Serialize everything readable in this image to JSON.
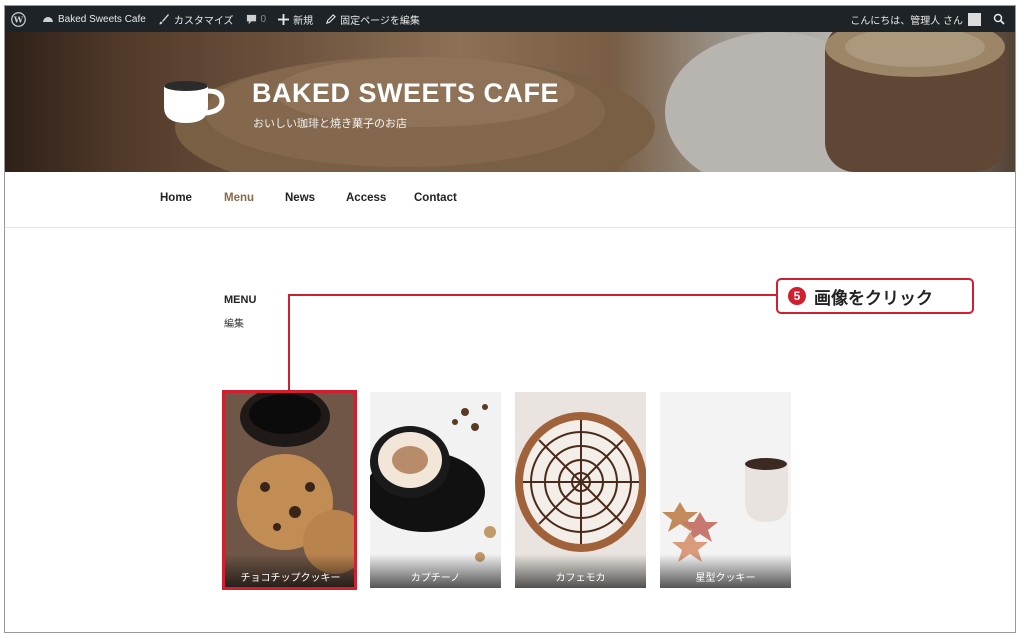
{
  "admin_bar": {
    "wp_logo_icon": "wordpress-icon",
    "site_name": "Baked Sweets Cafe",
    "customize": "カスタマイズ",
    "comments_count": "0",
    "new": "新規",
    "edit_page": "固定ページを編集",
    "greeting": "こんにちは、管理人 さん"
  },
  "header": {
    "site_title": "BAKED SWEETS CAFE",
    "tagline": "おいしい珈琲と焼き菓子のお店"
  },
  "nav": {
    "items": [
      {
        "label": "Home"
      },
      {
        "label": "Menu",
        "active": true
      },
      {
        "label": "News"
      },
      {
        "label": "Access"
      },
      {
        "label": "Contact"
      }
    ]
  },
  "content": {
    "heading": "MENU",
    "edit_link": "編集"
  },
  "gallery": {
    "items": [
      {
        "caption": "チョコチップクッキー"
      },
      {
        "caption": "カプチーノ"
      },
      {
        "caption": "カフェモカ"
      },
      {
        "caption": "星型クッキー"
      }
    ]
  },
  "callout": {
    "number": "5",
    "text": "画像をクリック"
  },
  "colors": {
    "admin_bar_bg": "#1d2327",
    "nav_active": "#8a6a4a",
    "callout_red": "#d11f30"
  }
}
